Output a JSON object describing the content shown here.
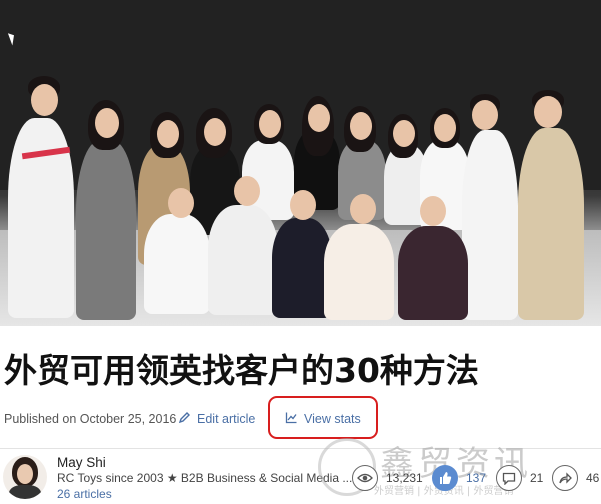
{
  "article": {
    "title": "外贸可用领英找客户的30种方法",
    "published": "Published on October 25, 2016",
    "edit_label": "Edit article",
    "stats_label": "View stats"
  },
  "author": {
    "name": "May Shi",
    "headline": "RC Toys since 2003 ★ B2B Business & Social Media ...",
    "articles": "26 articles"
  },
  "social": {
    "views": "13,231",
    "likes": "137",
    "comments": "21",
    "shares": "46"
  },
  "watermark": {
    "big": "鑫贸资讯",
    "small": "外贸营销 | 外贸资讯 | 外贸营销"
  },
  "colors": {
    "link": "#4a6fa5",
    "highlight_ring": "#d81e1e",
    "like_active": "#5b8bd0"
  }
}
